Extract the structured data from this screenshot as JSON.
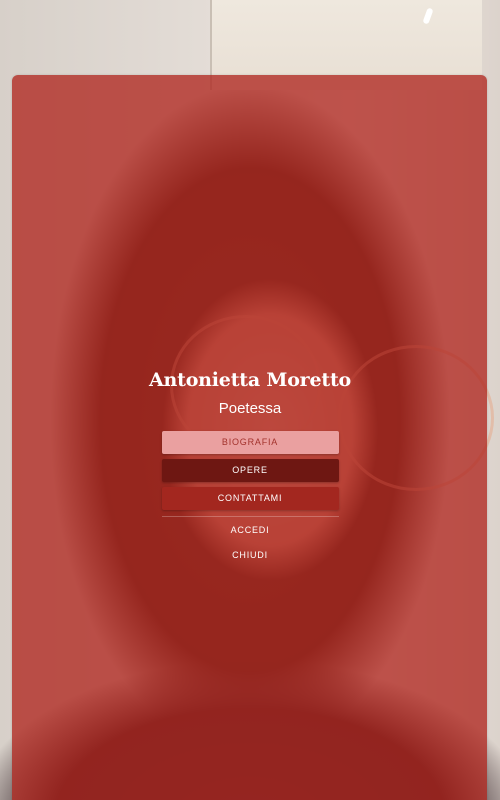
{
  "profile": {
    "name": "Antonietta Moretto",
    "role": "Poetessa"
  },
  "menu": {
    "items": [
      {
        "label": "BIOGRAFIA"
      },
      {
        "label": "OPERE"
      },
      {
        "label": "CONTATTAMI"
      }
    ]
  },
  "actions": {
    "login": "ACCEDI",
    "close": "CHIUDI"
  },
  "colors": {
    "overlay": "#b02820",
    "active_item": "#eaa0a0",
    "opere_item": "#6e1712",
    "contatti_item": "#a3271f"
  }
}
